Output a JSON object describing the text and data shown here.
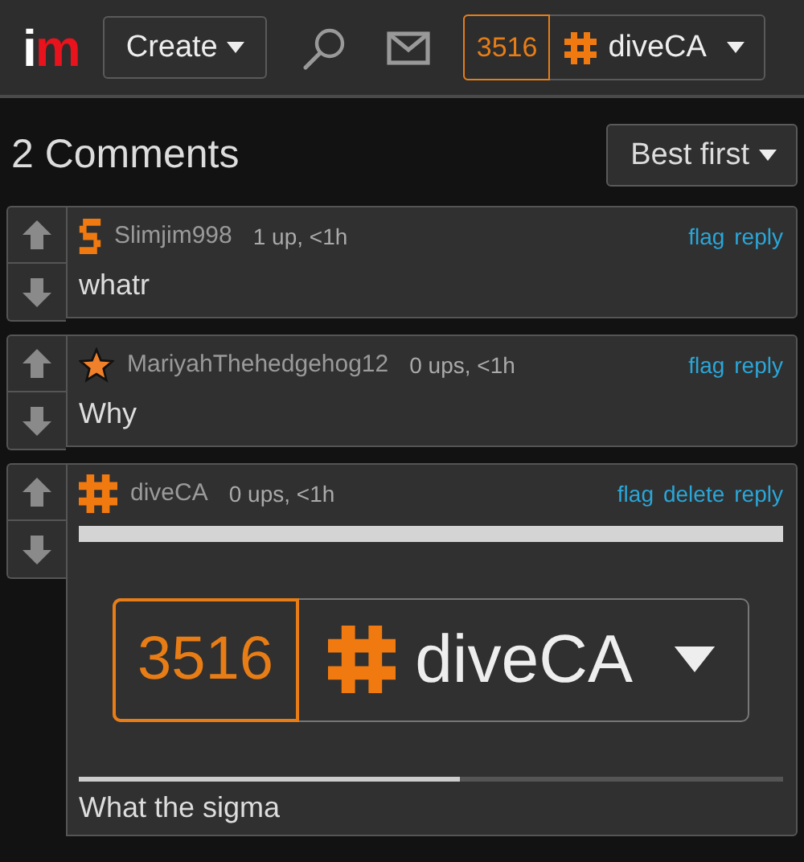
{
  "header": {
    "logo": "im",
    "create_button": "Create",
    "points": "3516",
    "username": "diveCA"
  },
  "comments_title": "2 Comments",
  "sort_button": "Best first",
  "comments": [
    {
      "avatar": {
        "kind": "s-blocks"
      },
      "username": "Slimjim998",
      "meta": "1 up, <1h",
      "actions": [
        "flag",
        "reply"
      ],
      "text": "whatr"
    },
    {
      "avatar": {
        "kind": "star"
      },
      "username": "MariyahThehedgehog12",
      "meta": "0 ups, <1h",
      "actions": [
        "flag",
        "reply"
      ],
      "text": "Why"
    },
    {
      "avatar": {
        "kind": "hash"
      },
      "username": "diveCA",
      "meta": "0 ups, <1h",
      "actions": [
        "flag",
        "delete",
        "reply"
      ],
      "image": {
        "kind": "screenshot",
        "points": "3516",
        "username": "diveCA"
      },
      "text": "What the sigma"
    }
  ]
}
